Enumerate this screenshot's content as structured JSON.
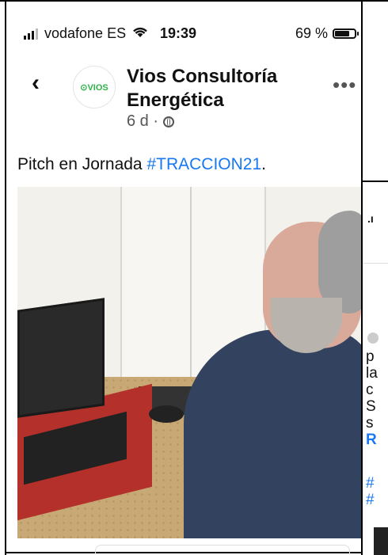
{
  "status_bar": {
    "carrier": "vodafone ES",
    "time": "19:39",
    "battery": "69 %",
    "icons": [
      "signal-icon",
      "wifi-icon",
      "battery-icon"
    ]
  },
  "post": {
    "page_name": "Vios Consultoría Energética",
    "avatar_text": "⊙VIOS",
    "age": "6 d ·",
    "more": "•••",
    "caption_prefix": "Pitch en Jornada ",
    "caption_hashtag": "#TRACCION21",
    "caption_suffix": "."
  },
  "second_post": {
    "status_fragment": ".ı",
    "text_lines": [
      "p",
      "la",
      "c",
      "S",
      "s"
    ],
    "link_fragment": "R",
    "tag_lines": [
      "#",
      "#"
    ]
  },
  "colors": {
    "link": "#1877f2",
    "brand_green": "#2db34a"
  }
}
